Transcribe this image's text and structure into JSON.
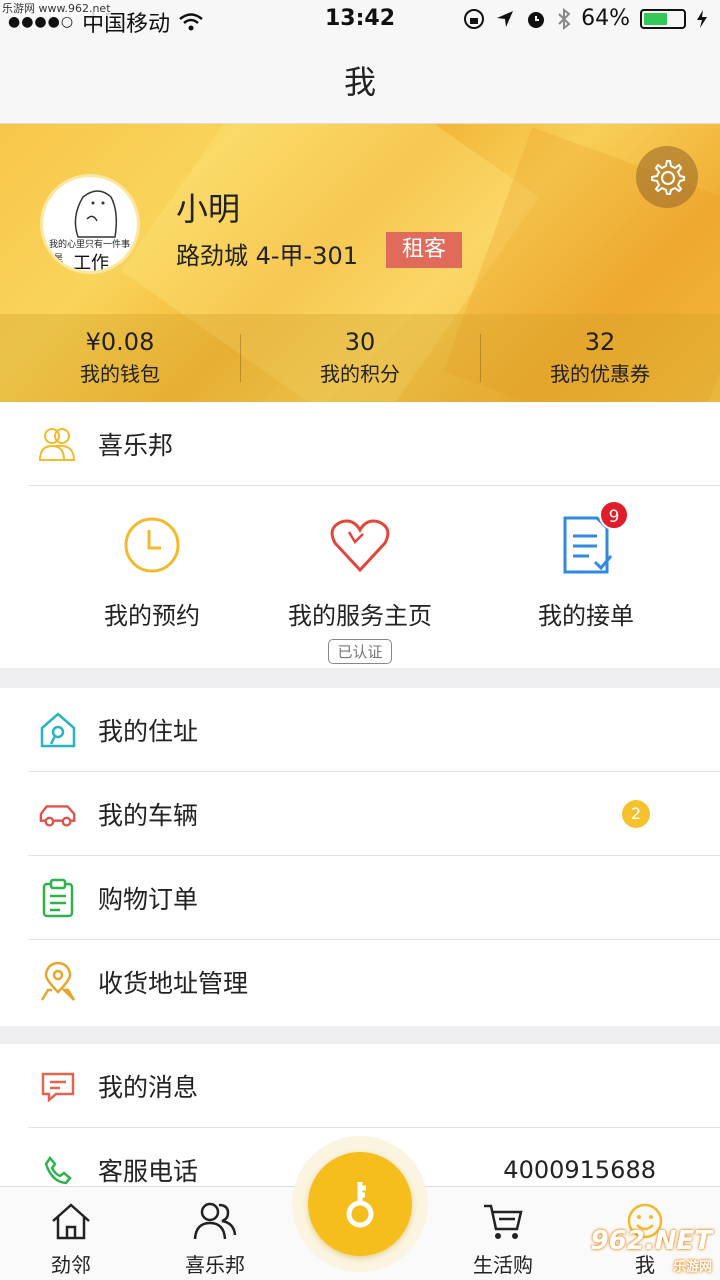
{
  "watermark_top": "乐游网 www.962.net",
  "status": {
    "signal": "●●●●○",
    "carrier": "中国移动",
    "time": "13:42",
    "battery": "64%",
    "battery_level": 0.64
  },
  "nav": {
    "title": "我"
  },
  "profile": {
    "avatar_caption": "我的心里只有一件事",
    "avatar_caption_side": "就是",
    "avatar_big": "工作",
    "name": "小明",
    "address": "路劲城 4-甲-301",
    "role": "租客",
    "stats": [
      {
        "value": "¥0.08",
        "label": "我的钱包"
      },
      {
        "value": "30",
        "label": "我的积分"
      },
      {
        "value": "32",
        "label": "我的优惠券"
      }
    ]
  },
  "community": {
    "title": "喜乐邦",
    "services": [
      {
        "label": "我的预约"
      },
      {
        "label": "我的服务主页",
        "tag": "已认证"
      },
      {
        "label": "我的接单",
        "badge": "9"
      }
    ]
  },
  "menu1": [
    {
      "label": "我的住址",
      "icon": "house-key-icon"
    },
    {
      "label": "我的车辆",
      "icon": "car-icon",
      "badge": "2"
    },
    {
      "label": "购物订单",
      "icon": "clipboard-icon"
    },
    {
      "label": "收货地址管理",
      "icon": "location-pin-icon"
    }
  ],
  "menu2": [
    {
      "label": "我的消息",
      "icon": "message-icon"
    },
    {
      "label": "客服电话",
      "icon": "phone-icon",
      "value": "4000915688"
    }
  ],
  "tabs": [
    {
      "label": "劲邻",
      "icon": "home-icon"
    },
    {
      "label": "喜乐邦",
      "icon": "people-icon"
    },
    {
      "label": "",
      "icon": "key-icon"
    },
    {
      "label": "生活购",
      "icon": "cart-icon"
    },
    {
      "label": "我",
      "icon": "smiley-icon"
    }
  ],
  "watermark_br": {
    "big": "962.NET",
    "small": "乐游网"
  },
  "colors": {
    "accent": "#f6be1c",
    "role_badge": "#e06b5a",
    "red_badge": "#e01d2a"
  }
}
